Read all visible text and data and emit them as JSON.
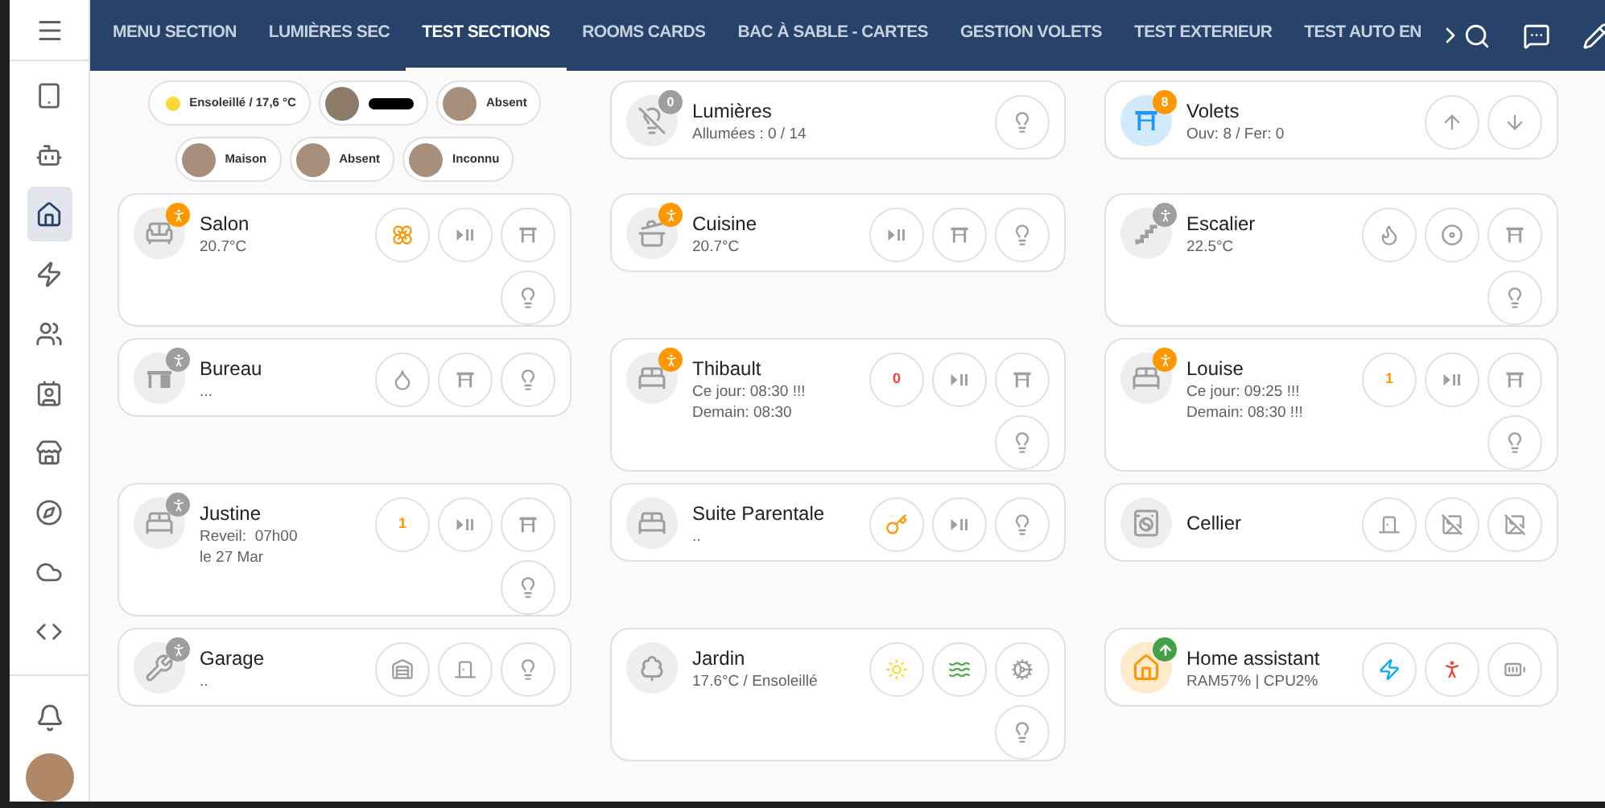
{
  "tabs": [
    {
      "label": "MENU SECTION",
      "selected": false
    },
    {
      "label": "LUMIÈRES SEC",
      "selected": false
    },
    {
      "label": "TEST SECTIONS",
      "selected": true
    },
    {
      "label": "ROOMS CARDS",
      "selected": false
    },
    {
      "label": "BAC À SABLE - CARTES",
      "selected": false
    },
    {
      "label": "GESTION VOLETS",
      "selected": false
    },
    {
      "label": "TEST EXTERIEUR",
      "selected": false
    },
    {
      "label": "TEST AUTO EN",
      "selected": false
    }
  ],
  "sidebar": {
    "items": [
      {
        "selected": false
      },
      {
        "selected": false
      },
      {
        "selected": true
      },
      {
        "selected": false
      },
      {
        "selected": false
      },
      {
        "selected": false
      },
      {
        "selected": false
      },
      {
        "selected": false
      },
      {
        "selected": false
      },
      {
        "selected": false
      }
    ]
  },
  "rows": [
    {
      "items": [
        {
          "kind": "chips",
          "chips": [
            {
              "kind": "weather",
              "color": "#fdd835",
              "text": "Ensoleillé / 17,6 °C"
            },
            {
              "kind": "redacted"
            },
            {
              "kind": "person",
              "text": "Absent"
            },
            {
              "kind": "person",
              "text": "Maison"
            },
            {
              "kind": "person",
              "text": "Absent"
            },
            {
              "kind": "person",
              "text": "Inconnu"
            }
          ]
        },
        {
          "kind": "room",
          "name": "Lumières",
          "badge": {
            "kind": "count",
            "text": "0",
            "color": "#9e9e9e"
          },
          "lines": [
            "Allumées : 0 / 14"
          ],
          "buttons": [
            {
              "kind": "lightbulb"
            }
          ]
        },
        {
          "kind": "room",
          "name": "Volets",
          "color": "#2196f3",
          "badge": {
            "kind": "count",
            "text": "8",
            "color": "#ff9800"
          },
          "lines": [
            "Ouv: 8 / Fer: 0"
          ],
          "buttons": [
            {
              "kind": "up"
            },
            {
              "kind": "down"
            }
          ]
        }
      ]
    },
    {
      "items": [
        {
          "kind": "room",
          "name": "Salon",
          "badge": {
            "kind": "motion",
            "active": true
          },
          "lines": [
            "20.7°C"
          ],
          "buttons": [
            {
              "kind": "flower",
              "color": "#ff9800"
            },
            {
              "kind": "playpause"
            },
            {
              "kind": "shutter"
            },
            {
              "kind": "lightbulb"
            }
          ]
        },
        {
          "kind": "room",
          "name": "Cuisine",
          "badge": {
            "kind": "motion",
            "active": true
          },
          "lines": [
            "20.7°C"
          ],
          "buttons": [
            {
              "kind": "playpause"
            },
            {
              "kind": "shutter"
            },
            {
              "kind": "lightbulb"
            }
          ]
        },
        {
          "kind": "room",
          "name": "Escalier",
          "badge": {
            "kind": "motion",
            "active": false
          },
          "lines": [
            "22.5°C"
          ],
          "buttons": [
            {
              "kind": "flame"
            },
            {
              "kind": "disc"
            },
            {
              "kind": "shutter"
            },
            {
              "kind": "lightbulb"
            }
          ]
        }
      ]
    },
    {
      "items": [
        {
          "kind": "room",
          "name": "Bureau",
          "badge": {
            "kind": "motion",
            "active": false
          },
          "lines": [
            "..."
          ],
          "buttons": [
            {
              "kind": "droplet"
            },
            {
              "kind": "shutter"
            },
            {
              "kind": "lightbulb"
            }
          ]
        },
        {
          "kind": "room",
          "name": "Thibault",
          "badge": {
            "kind": "motion",
            "active": true
          },
          "lines": [
            "Ce jour: 08:30 !!!",
            "Demain: 08:30"
          ],
          "buttons": [
            {
              "kind": "text",
              "label": "0",
              "color": "#f44336"
            },
            {
              "kind": "playpause"
            },
            {
              "kind": "shutter"
            },
            {
              "kind": "lightbulb"
            }
          ]
        },
        {
          "kind": "room",
          "name": "Louise",
          "badge": {
            "kind": "motion",
            "active": true
          },
          "lines": [
            "Ce jour: 09:25 !!!",
            "Demain: 08:30 !!!"
          ],
          "buttons": [
            {
              "kind": "text",
              "label": "1",
              "color": "#ff9800"
            },
            {
              "kind": "playpause"
            },
            {
              "kind": "shutter"
            },
            {
              "kind": "lightbulb"
            }
          ]
        }
      ]
    },
    {
      "items": [
        {
          "kind": "room",
          "name": "Justine",
          "badge": {
            "kind": "motion",
            "active": false
          },
          "lines": [
            "Reveil:  07h00",
            "le 27 Mar"
          ],
          "buttons": [
            {
              "kind": "text",
              "label": "1",
              "color": "#ff9800"
            },
            {
              "kind": "playpause"
            },
            {
              "kind": "shutter"
            },
            {
              "kind": "lightbulb"
            }
          ]
        },
        {
          "kind": "room",
          "name": "Suite Parentale",
          "lines": [
            ".."
          ],
          "buttons": [
            {
              "kind": "key",
              "color": "#ff9800"
            },
            {
              "kind": "playpause"
            },
            {
              "kind": "lightbulb"
            }
          ]
        },
        {
          "kind": "room",
          "name": "Cellier",
          "buttons": [
            {
              "kind": "door"
            },
            {
              "kind": "crossed"
            },
            {
              "kind": "crossed"
            }
          ]
        }
      ]
    },
    {
      "items": [
        {
          "kind": "room",
          "name": "Garage",
          "badge": {
            "kind": "motion",
            "active": false
          },
          "lines": [
            ".."
          ],
          "buttons": [
            {
              "kind": "garage"
            },
            {
              "kind": "door"
            },
            {
              "kind": "lightbulb"
            }
          ]
        },
        {
          "kind": "room",
          "name": "Jardin",
          "lines": [
            "17.6°C / Ensoleillé"
          ],
          "buttons": [
            {
              "kind": "sun",
              "color": "#fdd835"
            },
            {
              "kind": "waves",
              "color": "#4caf50"
            },
            {
              "kind": "cog"
            },
            {
              "kind": "lightbulb"
            }
          ]
        },
        {
          "kind": "room",
          "name": "Home assistant",
          "color": "#ff9800",
          "badge": {
            "kind": "update"
          },
          "lines": [
            "RAM57% | CPU2%"
          ],
          "buttons": [
            {
              "kind": "zap",
              "color": "#03a9f4"
            },
            {
              "kind": "person",
              "color": "#f44336"
            },
            {
              "kind": "battery"
            }
          ]
        }
      ]
    }
  ]
}
